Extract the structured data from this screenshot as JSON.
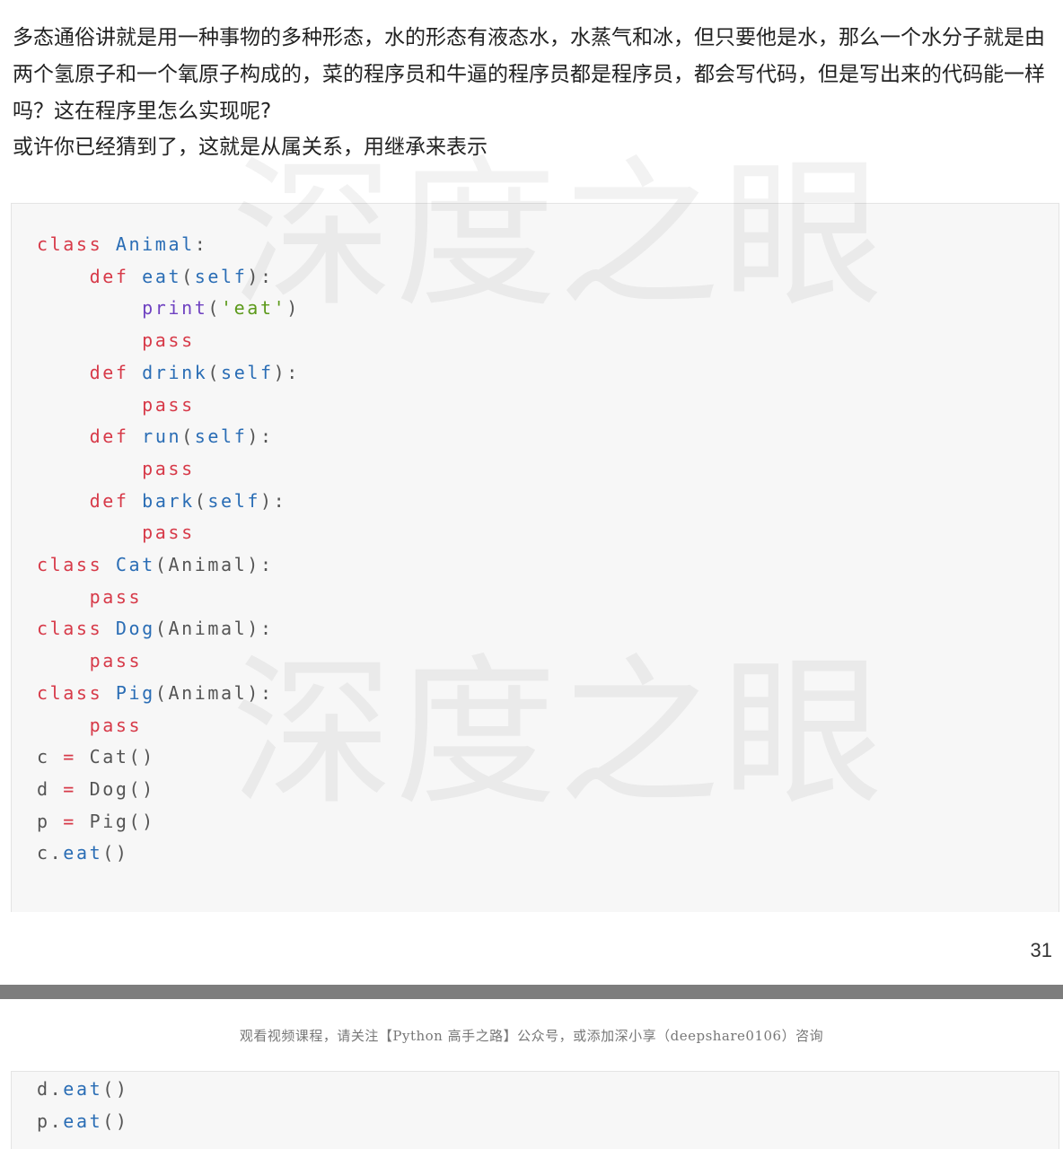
{
  "paragraphs": {
    "p1": "多态通俗讲就是用一种事物的多种形态，水的形态有液态水，水蒸气和冰，但只要他是水，那么一个水分子就是由两个氢原子和一个氧原子构成的，菜的程序员和牛逼的程序员都是程序员，都会写代码，但是写出来的代码能一样吗？这在程序里怎么实现呢?",
    "p2": "或许你已经猜到了，这就是从属关系，用继承来表示"
  },
  "watermark": "深度之眼",
  "code_block_1": {
    "lines": [
      [
        {
          "t": "class",
          "k": "kw"
        },
        {
          "t": " "
        },
        {
          "t": "Animal",
          "k": "fn"
        },
        {
          "t": ":"
        }
      ],
      [
        {
          "t": "    "
        },
        {
          "t": "def",
          "k": "kw"
        },
        {
          "t": " "
        },
        {
          "t": "eat",
          "k": "fn"
        },
        {
          "t": "("
        },
        {
          "t": "self",
          "k": "fn"
        },
        {
          "t": "):"
        }
      ],
      [
        {
          "t": "        "
        },
        {
          "t": "print",
          "k": "bi"
        },
        {
          "t": "("
        },
        {
          "t": "'eat'",
          "k": "st"
        },
        {
          "t": ")"
        }
      ],
      [
        {
          "t": "        "
        },
        {
          "t": "pass",
          "k": "kw"
        }
      ],
      [
        {
          "t": "    "
        },
        {
          "t": "def",
          "k": "kw"
        },
        {
          "t": " "
        },
        {
          "t": "drink",
          "k": "fn"
        },
        {
          "t": "("
        },
        {
          "t": "self",
          "k": "fn"
        },
        {
          "t": "):"
        }
      ],
      [
        {
          "t": "        "
        },
        {
          "t": "pass",
          "k": "kw"
        }
      ],
      [
        {
          "t": "    "
        },
        {
          "t": "def",
          "k": "kw"
        },
        {
          "t": " "
        },
        {
          "t": "run",
          "k": "fn"
        },
        {
          "t": "("
        },
        {
          "t": "self",
          "k": "fn"
        },
        {
          "t": "):"
        }
      ],
      [
        {
          "t": "        "
        },
        {
          "t": "pass",
          "k": "kw"
        }
      ],
      [
        {
          "t": "    "
        },
        {
          "t": "def",
          "k": "kw"
        },
        {
          "t": " "
        },
        {
          "t": "bark",
          "k": "fn"
        },
        {
          "t": "("
        },
        {
          "t": "self",
          "k": "fn"
        },
        {
          "t": "):"
        }
      ],
      [
        {
          "t": "        "
        },
        {
          "t": "pass",
          "k": "kw"
        }
      ],
      [
        {
          "t": "class",
          "k": "kw"
        },
        {
          "t": " "
        },
        {
          "t": "Cat",
          "k": "fn"
        },
        {
          "t": "(Animal):"
        }
      ],
      [
        {
          "t": "    "
        },
        {
          "t": "pass",
          "k": "kw"
        }
      ],
      [
        {
          "t": "class",
          "k": "kw"
        },
        {
          "t": " "
        },
        {
          "t": "Dog",
          "k": "fn"
        },
        {
          "t": "(Animal):"
        }
      ],
      [
        {
          "t": "    "
        },
        {
          "t": "pass",
          "k": "kw"
        }
      ],
      [
        {
          "t": "class",
          "k": "kw"
        },
        {
          "t": " "
        },
        {
          "t": "Pig",
          "k": "fn"
        },
        {
          "t": "(Animal):"
        }
      ],
      [
        {
          "t": "    "
        },
        {
          "t": "pass",
          "k": "kw"
        }
      ],
      [
        {
          "t": "c "
        },
        {
          "t": "=",
          "k": "kw"
        },
        {
          "t": " Cat()"
        }
      ],
      [
        {
          "t": "d "
        },
        {
          "t": "=",
          "k": "kw"
        },
        {
          "t": " Dog()"
        }
      ],
      [
        {
          "t": "p "
        },
        {
          "t": "=",
          "k": "kw"
        },
        {
          "t": " Pig()"
        }
      ],
      [
        {
          "t": "c."
        },
        {
          "t": "eat",
          "k": "fn"
        },
        {
          "t": "()"
        }
      ]
    ]
  },
  "page_number": "31",
  "footer_note": "观看视频课程，请关注【Python 高手之路】公众号，或添加深小享（deepshare0106）咨询",
  "code_block_2": {
    "lines": [
      [
        {
          "t": "d."
        },
        {
          "t": "eat",
          "k": "fn"
        },
        {
          "t": "()"
        }
      ],
      [
        {
          "t": "p."
        },
        {
          "t": "eat",
          "k": "fn"
        },
        {
          "t": "()"
        }
      ]
    ]
  }
}
